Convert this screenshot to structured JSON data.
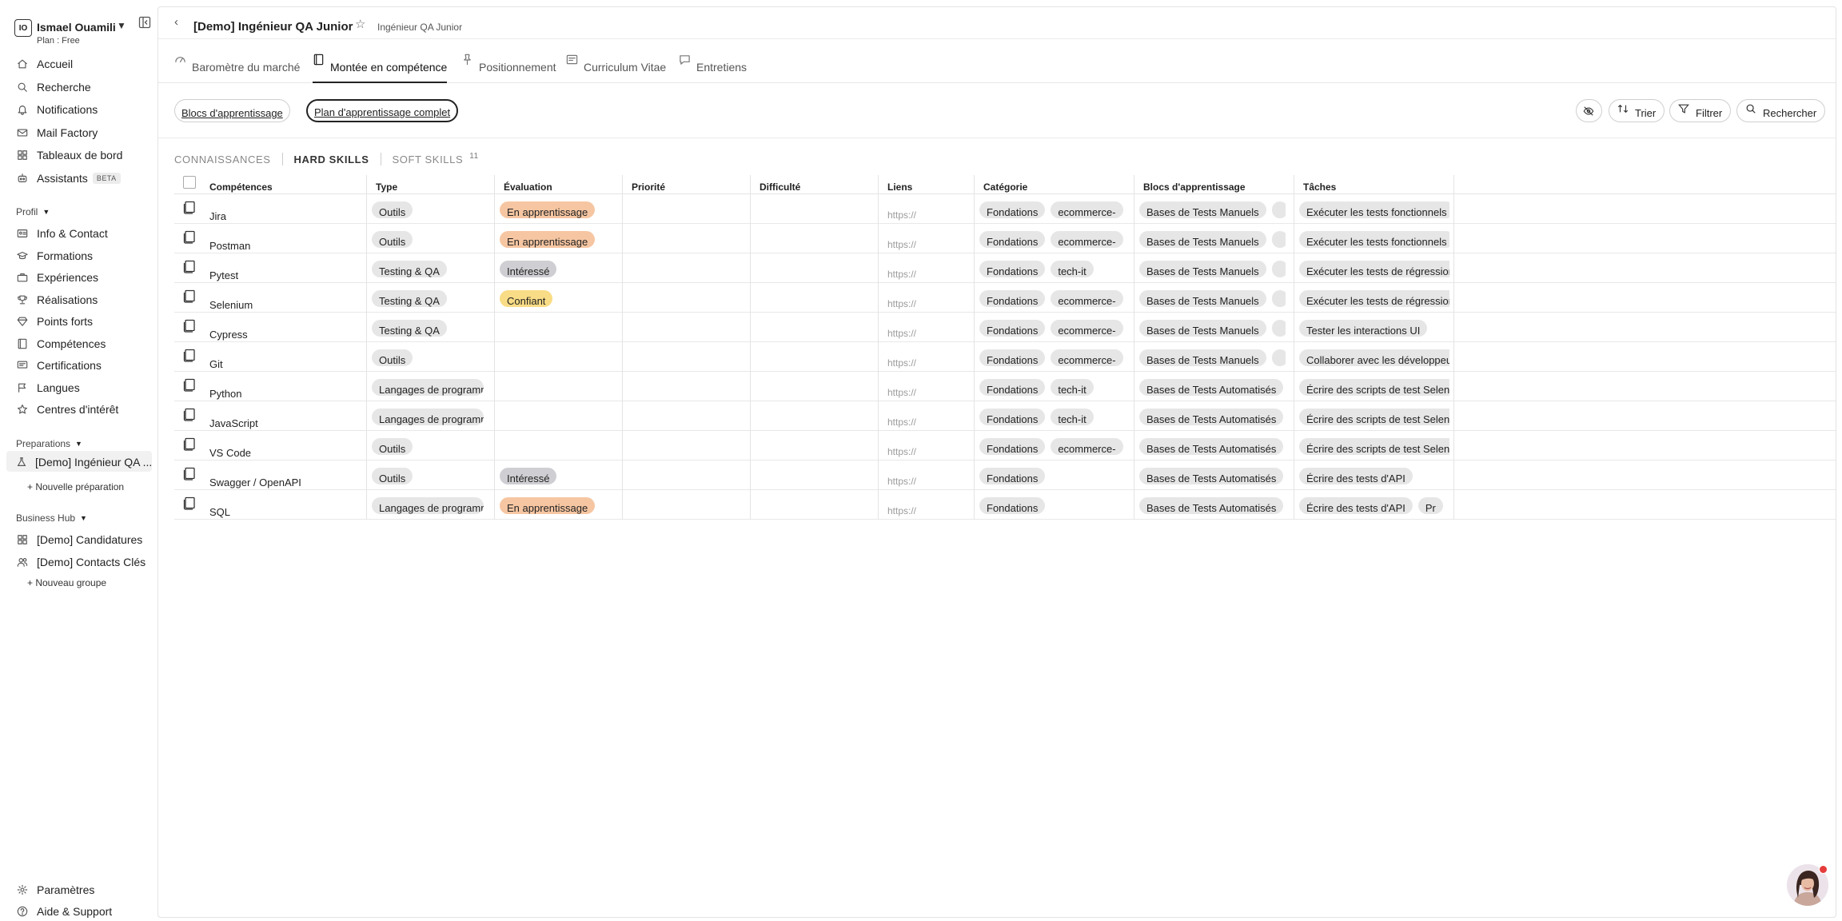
{
  "workspace": {
    "initials": "IO",
    "name": "Ismael Ouamili",
    "plan": "Plan : Free"
  },
  "nav": {
    "main": [
      {
        "label": "Accueil",
        "icon": "home-icon"
      },
      {
        "label": "Recherche",
        "icon": "search-icon"
      },
      {
        "label": "Notifications",
        "icon": "bell-icon"
      },
      {
        "label": "Mail Factory",
        "icon": "mail-icon"
      },
      {
        "label": "Tableaux de bord",
        "icon": "grid-icon"
      },
      {
        "label": "Assistants",
        "icon": "bot-icon",
        "badge": "BETA"
      }
    ],
    "profil_title": "Profil",
    "profil": [
      {
        "label": "Info & Contact",
        "icon": "id-card-icon"
      },
      {
        "label": "Formations",
        "icon": "graduation-icon"
      },
      {
        "label": "Expériences",
        "icon": "briefcase-icon"
      },
      {
        "label": "Réalisations",
        "icon": "trophy-icon"
      },
      {
        "label": "Points forts",
        "icon": "diamond-icon"
      },
      {
        "label": "Compétences",
        "icon": "book-icon"
      },
      {
        "label": "Certifications",
        "icon": "certificate-icon"
      },
      {
        "label": "Langues",
        "icon": "flag-icon"
      },
      {
        "label": "Centres d'intérêt",
        "icon": "star-icon"
      }
    ],
    "preparations_title": "Preparations",
    "preparation_active": "[Demo] Ingénieur QA ...",
    "new_preparation": "+ Nouvelle préparation",
    "business_title": "Business Hub",
    "business": [
      {
        "label": "[Demo] Candidatures",
        "icon": "grid-icon"
      },
      {
        "label": "[Demo] Contacts Clés",
        "icon": "users-icon"
      }
    ],
    "new_group": "+ Nouveau groupe",
    "bottom": [
      {
        "label": "Paramètres",
        "icon": "gear-icon"
      },
      {
        "label": "Aide & Support",
        "icon": "help-icon"
      }
    ]
  },
  "header": {
    "title": "[Demo] Ingénieur QA Junior",
    "subtitle": "Ingénieur QA Junior"
  },
  "tabs": [
    {
      "label": "Baromètre du marché",
      "icon": "gauge-icon"
    },
    {
      "label": "Montée en compétence",
      "icon": "book-icon"
    },
    {
      "label": "Positionnement",
      "icon": "pin-icon"
    },
    {
      "label": "Curriculum Vitae",
      "icon": "cv-icon"
    },
    {
      "label": "Entretiens",
      "icon": "chat-icon"
    }
  ],
  "toolbar": {
    "pill1": "Blocs d'apprentissage",
    "pill2": "Plan d'apprentissage complet",
    "sort": "Trier",
    "filter": "Filtrer",
    "search": "Rechercher"
  },
  "subtabs": {
    "a": "CONNAISSANCES",
    "b": "HARD SKILLS",
    "c": "SOFT SKILLS",
    "count": "11"
  },
  "columns": [
    "Compétences",
    "Type",
    "Évaluation",
    "Priorité",
    "Difficulté",
    "Liens",
    "Catégorie",
    "Blocs d'apprentissage",
    "Tâches"
  ],
  "rows": [
    {
      "skill": "Jira",
      "type": "Outils",
      "eval": "En apprentissage",
      "evalColor": "#f6c6a2",
      "link": "https://",
      "cats": [
        "Fondations",
        "ecommerce-"
      ],
      "bloc": "Bases de Tests Manuels",
      "tasks": [
        "Exécuter les tests fonctionnels"
      ]
    },
    {
      "skill": "Postman",
      "type": "Outils",
      "eval": "En apprentissage",
      "evalColor": "#f6c6a2",
      "link": "https://",
      "cats": [
        "Fondations",
        "ecommerce-"
      ],
      "bloc": "Bases de Tests Manuels",
      "tasks": [
        "Exécuter les tests fonctionnels"
      ]
    },
    {
      "skill": "Pytest",
      "type": "Testing & QA",
      "eval": "Intéressé",
      "evalColor": "#cfcfd3",
      "link": "https://",
      "cats": [
        "Fondations",
        "tech-it"
      ],
      "bloc": "Bases de Tests Manuels",
      "tasks": [
        "Exécuter les tests de régression"
      ]
    },
    {
      "skill": "Selenium",
      "type": "Testing & QA",
      "eval": "Confiant",
      "evalColor": "#f9dc86",
      "link": "https://",
      "cats": [
        "Fondations",
        "ecommerce-"
      ],
      "bloc": "Bases de Tests Manuels",
      "tasks": [
        "Exécuter les tests de régression"
      ]
    },
    {
      "skill": "Cypress",
      "type": "Testing & QA",
      "eval": "",
      "evalColor": "",
      "link": "https://",
      "cats": [
        "Fondations",
        "ecommerce-"
      ],
      "bloc": "Bases de Tests Manuels",
      "tasks": [
        "Tester les interactions UI"
      ]
    },
    {
      "skill": "Git",
      "type": "Outils",
      "eval": "",
      "evalColor": "",
      "link": "https://",
      "cats": [
        "Fondations",
        "ecommerce-"
      ],
      "bloc": "Bases de Tests Manuels",
      "tasks": [
        "Collaborer avec les développeurs"
      ]
    },
    {
      "skill": "Python",
      "type": "Langages de programmation",
      "eval": "",
      "evalColor": "",
      "link": "https://",
      "cats": [
        "Fondations",
        "tech-it"
      ],
      "bloc": "Bases de Tests Automatisés",
      "tasks": [
        "Écrire des scripts de test Selenium"
      ]
    },
    {
      "skill": "JavaScript",
      "type": "Langages de programmation",
      "eval": "",
      "evalColor": "",
      "link": "https://",
      "cats": [
        "Fondations",
        "tech-it"
      ],
      "bloc": "Bases de Tests Automatisés",
      "tasks": [
        "Écrire des scripts de test Selenium"
      ]
    },
    {
      "skill": "VS Code",
      "type": "Outils",
      "eval": "",
      "evalColor": "",
      "link": "https://",
      "cats": [
        "Fondations",
        "ecommerce-"
      ],
      "bloc": "Bases de Tests Automatisés",
      "tasks": [
        "Écrire des scripts de test Selenium"
      ]
    },
    {
      "skill": "Swagger / OpenAPI",
      "type": "Outils",
      "eval": "Intéressé",
      "evalColor": "#cfcfd3",
      "link": "https://",
      "cats": [
        "Fondations"
      ],
      "bloc": "Bases de Tests Automatisés",
      "tasks": [
        "Écrire des tests d'API"
      ]
    },
    {
      "skill": "SQL",
      "type": "Langages de programmation",
      "eval": "En apprentissage",
      "evalColor": "#f6c6a2",
      "link": "https://",
      "cats": [
        "Fondations"
      ],
      "bloc": "Bases de Tests Automatisés",
      "tasks": [
        "Écrire des tests d'API",
        "Pr"
      ]
    }
  ]
}
